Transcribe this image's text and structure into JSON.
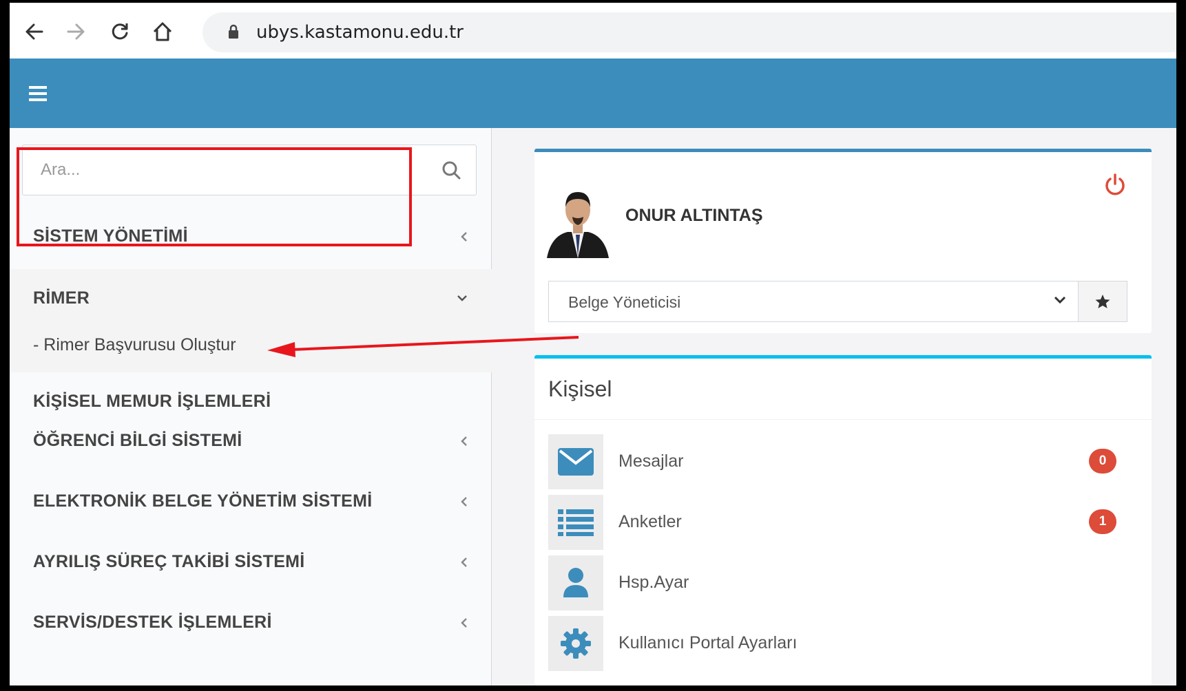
{
  "browser": {
    "url": "ubys.kastamonu.edu.tr"
  },
  "sidebar": {
    "search_placeholder": "Ara...",
    "items": [
      {
        "label": "SİSTEM YÖNETİMİ",
        "chevron": "left"
      },
      {
        "label": "RİMER",
        "chevron": "down",
        "subitems": [
          "- Rimer Başvurusu Oluştur"
        ]
      },
      {
        "label": "KİŞİSEL MEMUR İŞLEMLERİ",
        "chevron": "none"
      },
      {
        "label": "ÖĞRENCİ BİLGİ SİSTEMİ",
        "chevron": "left"
      },
      {
        "label": "ELEKTRONİK BELGE YÖNETİM SİSTEMİ",
        "chevron": "left"
      },
      {
        "label": "AYRILIŞ SÜREÇ TAKİBİ SİSTEMİ",
        "chevron": "left"
      },
      {
        "label": "SERVİS/DESTEK İŞLEMLERİ",
        "chevron": "left"
      }
    ]
  },
  "profile": {
    "name": "ONUR ALTINTAŞ",
    "role_selected": "Belge Yöneticisi"
  },
  "kisisel": {
    "title": "Kişisel",
    "items": [
      {
        "label": "Mesajlar",
        "icon": "envelope-icon",
        "badge": "0"
      },
      {
        "label": "Anketler",
        "icon": "list-icon",
        "badge": "1"
      },
      {
        "label": "Hsp.Ayar",
        "icon": "user-icon",
        "badge": null
      },
      {
        "label": "Kullanıcı Portal Ayarları",
        "icon": "gear-icon",
        "badge": null
      }
    ]
  },
  "colors": {
    "header": "#3c8dbc",
    "kisisel_accent": "#00c0ef",
    "badge": "#dd4b39",
    "annotation": "#e8161c"
  }
}
